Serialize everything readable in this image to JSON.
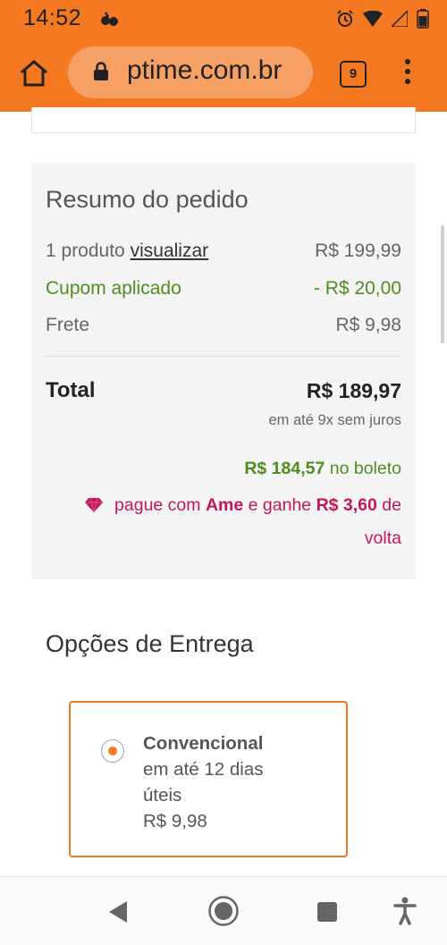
{
  "status_bar": {
    "time": "14:52",
    "battery": "64"
  },
  "browser": {
    "url": "ptime.com.br",
    "tab_count": "9"
  },
  "summary": {
    "title": "Resumo do pedido",
    "product_label": "1 produto",
    "product_link": "visualizar",
    "product_price": "R$ 199,99",
    "coupon_label": "Cupom aplicado",
    "coupon_value": "- R$ 20,00",
    "shipping_label": "Frete",
    "shipping_value": "R$ 9,98",
    "total_label": "Total",
    "total_value": "R$ 189,97",
    "installments": "em até 9x sem juros",
    "boleto_value": "R$ 184,57",
    "boleto_suffix": "no boleto",
    "ame_text_1": "pague com",
    "ame_brand": "Ame",
    "ame_text_2": "e ganhe",
    "ame_cashback": "R$ 3,60",
    "ame_text_3": "de",
    "ame_text_4": "volta"
  },
  "delivery": {
    "title": "Opções de Entrega",
    "option": {
      "name": "Convencional",
      "line1": "em até 12 dias",
      "line2": "úteis",
      "price": "R$ 9,98",
      "selected": true
    }
  },
  "colors": {
    "brand_orange": "#f47920",
    "green": "#4e8d1f",
    "ame_pink": "#c2185b"
  }
}
